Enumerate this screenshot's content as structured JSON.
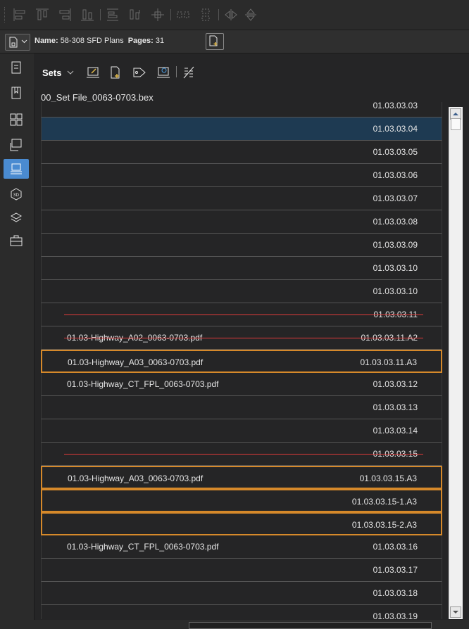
{
  "toolbar2": {
    "name_label": "Name:",
    "name_value": "58-308 SFD Plans",
    "pages_label": "Pages:",
    "pages_value": "31"
  },
  "sets_panel": {
    "title": "Sets",
    "file_name": "00_Set File_0063-0703.bex"
  },
  "rows": [
    {
      "name": "",
      "code": "01.03.03.03"
    },
    {
      "name": "",
      "code": "01.03.03.04",
      "selected": true
    },
    {
      "name": "",
      "code": "01.03.03.05"
    },
    {
      "name": "",
      "code": "01.03.03.06"
    },
    {
      "name": "",
      "code": "01.03.03.07"
    },
    {
      "name": "",
      "code": "01.03.03.08"
    },
    {
      "name": "",
      "code": "01.03.03.09"
    },
    {
      "name": "",
      "code": "01.03.03.10"
    },
    {
      "name": "",
      "code": "01.03.03.10"
    },
    {
      "name": "",
      "code": "01.03.03.11",
      "struck": true
    },
    {
      "name": "01.03-Highway_A02_0063-0703.pdf",
      "code": "01.03.03.11.A2",
      "struck": true
    },
    {
      "name": "01.03-Highway_A03_0063-0703.pdf",
      "code": "01.03.03.11.A3",
      "outlined": true
    },
    {
      "name": "01.03-Highway_CT_FPL_0063-0703.pdf",
      "code": "01.03.03.12"
    },
    {
      "name": "",
      "code": "01.03.03.13"
    },
    {
      "name": "",
      "code": "01.03.03.14"
    },
    {
      "name": "",
      "code": "01.03.03.15",
      "struck": true
    },
    {
      "name": "01.03-Highway_A03_0063-0703.pdf",
      "code": "01.03.03.15.A3",
      "outlined": true
    },
    {
      "name": "",
      "code": "01.03.03.15-1.A3",
      "outlined": true
    },
    {
      "name": "",
      "code": "01.03.03.15-2.A3",
      "outlined": true
    },
    {
      "name": "01.03-Highway_CT_FPL_0063-0703.pdf",
      "code": "01.03.03.16"
    },
    {
      "name": "",
      "code": "01.03.03.17"
    },
    {
      "name": "",
      "code": "01.03.03.18"
    },
    {
      "name": "",
      "code": "01.03.03.19"
    }
  ],
  "left_rail_icons": [
    "properties-icon",
    "bookmarks-icon",
    "thumbnails-icon",
    "markups-icon",
    "sets-icon",
    "3d-icon",
    "layers-icon",
    "toolchest-icon"
  ],
  "colors": {
    "selected_row": "#1e3a52",
    "outline_highlight": "#d6892a",
    "strike_line": "#e03a3a",
    "active_rail": "#4a8bd1"
  }
}
